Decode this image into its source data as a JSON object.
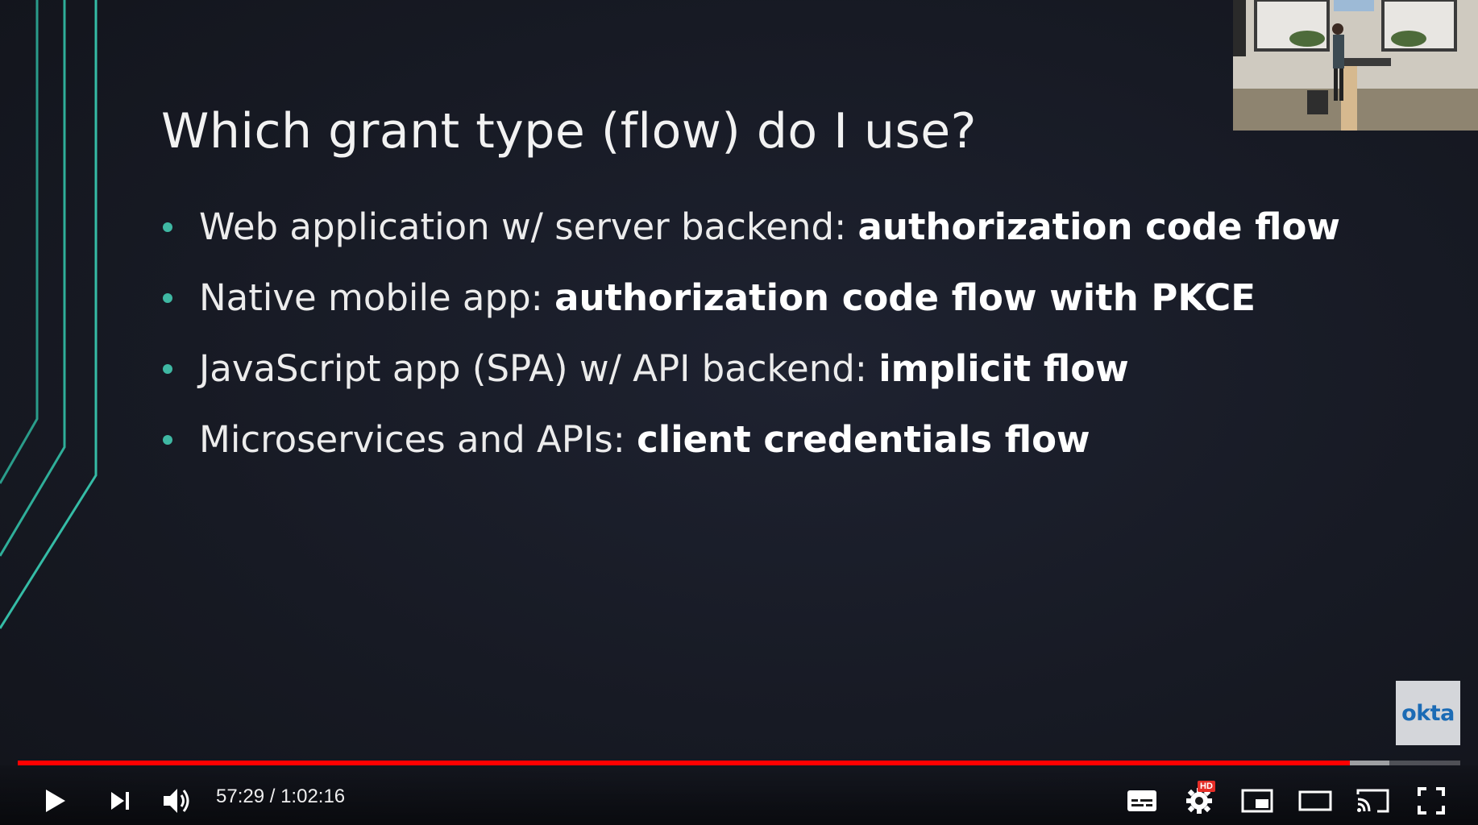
{
  "slide": {
    "title": "Which grant type (flow) do I use?",
    "bullets": [
      {
        "text": "Web application w/ server backend: ",
        "bold": "authorization code flow"
      },
      {
        "text": "Native mobile app: ",
        "bold": "authorization code flow with PKCE"
      },
      {
        "text": "JavaScript app (SPA) w/ API backend: ",
        "bold": "implicit flow"
      },
      {
        "text": "Microservices and APIs: ",
        "bold": "client credentials flow"
      }
    ],
    "logo": "okta"
  },
  "player": {
    "time_current": "57:29",
    "time_sep": " / ",
    "time_total": "1:02:16",
    "played_fraction": 0.9235,
    "buffered_fraction": 0.951,
    "hd_label": "HD",
    "accent_color": "#ff0000"
  },
  "icons": {
    "play": "play-icon",
    "next": "next-icon",
    "volume": "volume-icon",
    "subtitles": "subtitles-icon",
    "settings": "settings-icon",
    "miniplayer": "miniplayer-icon",
    "theater": "theater-mode-icon",
    "cast": "cast-icon",
    "fullscreen": "fullscreen-icon"
  }
}
